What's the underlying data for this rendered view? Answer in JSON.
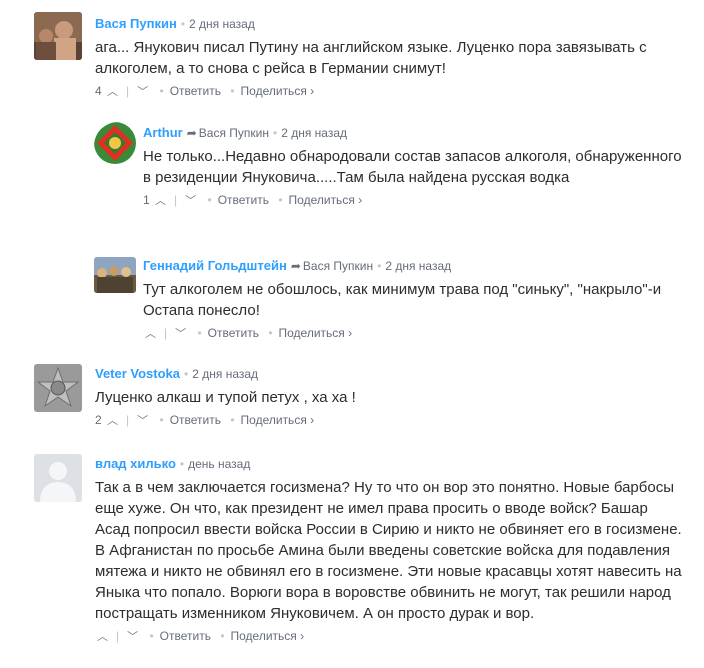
{
  "comments": [
    {
      "author": "Вася Пупкин",
      "time": "2 дня назад",
      "text": "ага... Янукович писал Путину на английском языке. Луценко пора завязывать с алкоголем, а то снова с рейса в Германии снимут!",
      "votes": "4",
      "reply": "Ответить",
      "share": "Поделиться ›"
    },
    {
      "author": "Arthur",
      "reply_to": "Вася Пупкин",
      "time": "2 дня назад",
      "text": "Не только...Недавно обнародовали состав запасов алкоголя, обнаруженного в резиденции Януковича.....Там была найдена русская водка",
      "votes": "1",
      "reply": "Ответить",
      "share": "Поделиться ›"
    },
    {
      "author": "Геннадий Гольдштейн",
      "reply_to": "Вася Пупкин",
      "time": "2 дня назад",
      "text": "Тут алкоголем не обошлось, как минимум трава под \"синьку\", \"накрыло\"-и Остапа понесло!",
      "votes": "",
      "reply": "Ответить",
      "share": "Поделиться ›"
    },
    {
      "author": "Veter Vostoka",
      "time": "2 дня назад",
      "text": "Луценко алкаш и тупой петух , ха ха !",
      "votes": "2",
      "reply": "Ответить",
      "share": "Поделиться ›"
    },
    {
      "author": "влад хилько",
      "time": "день назад",
      "text": "Так а в чем заключается госизмена? Ну то что он вор это понятно. Новые барбосы еще хуже. Он что, как президент не имел права просить о вводе войск? Башар Асад попросил ввести войска России в Сирию и никто не обвиняет его в госизмене. В Афганистан по просьбе Амина были введены советские войска для подавления мятежа и никто не обвинял его в госизмене. Эти новые красавцы хотят навесить на Яныка что попало. Ворюги вора в воровстве обвинить не могут, так решили народ постращать изменником Януковичем. А он просто дурак и вор.",
      "votes": "",
      "reply": "Ответить",
      "share": "Поделиться ›"
    }
  ],
  "icons": {
    "upvote": "chevron-up-icon",
    "downvote": "chevron-down-icon",
    "reply_arrow": "reply-arrow-icon"
  }
}
